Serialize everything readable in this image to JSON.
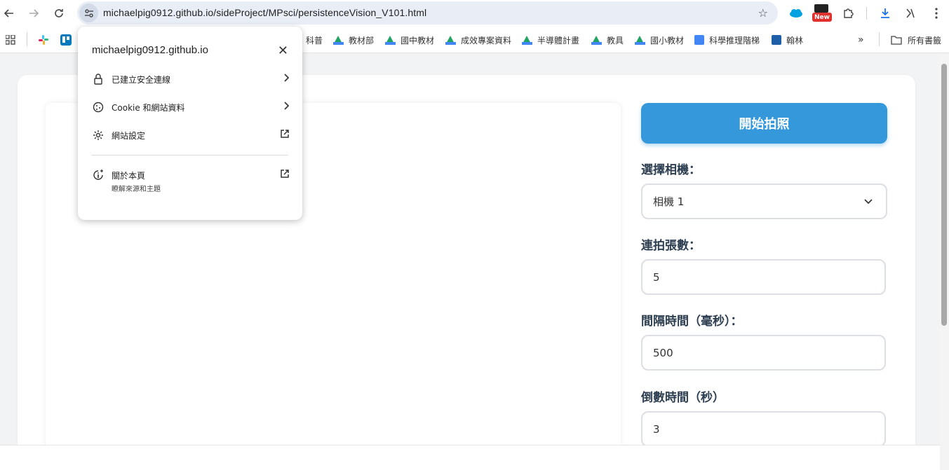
{
  "browser": {
    "url": "michaelpig0912.github.io/sideProject/MPsci/persistenceVision_V101.html",
    "extension_badge": "New"
  },
  "bookmarks": {
    "items": [
      {
        "label": "科普"
      },
      {
        "label": "教材部"
      },
      {
        "label": "國中教材"
      },
      {
        "label": "成效專案資料"
      },
      {
        "label": "半導體計畫"
      },
      {
        "label": "教具"
      },
      {
        "label": "國小教材"
      },
      {
        "label": "科學推理階梯"
      },
      {
        "label": "翰林"
      }
    ],
    "all_bookmarks": "所有書籤"
  },
  "site_info": {
    "domain": "michaelpig0912.github.io",
    "secure_connection": "已建立安全連線",
    "cookies": "Cookie 和網站資料",
    "site_settings": "網站設定",
    "about_page": "關於本頁",
    "about_sub": "瞭解來源和主題"
  },
  "controls": {
    "start_button": "開始拍照",
    "camera_label": "選擇相機：",
    "camera_value": "相機 1",
    "burst_label": "連拍張數：",
    "burst_value": "5",
    "interval_label": "間隔時間（毫秒）：",
    "interval_value": "500",
    "countdown_label": "倒數時間（秒）",
    "countdown_value": "3"
  },
  "colors": {
    "accent": "#3498db",
    "label": "#2c3e50"
  }
}
